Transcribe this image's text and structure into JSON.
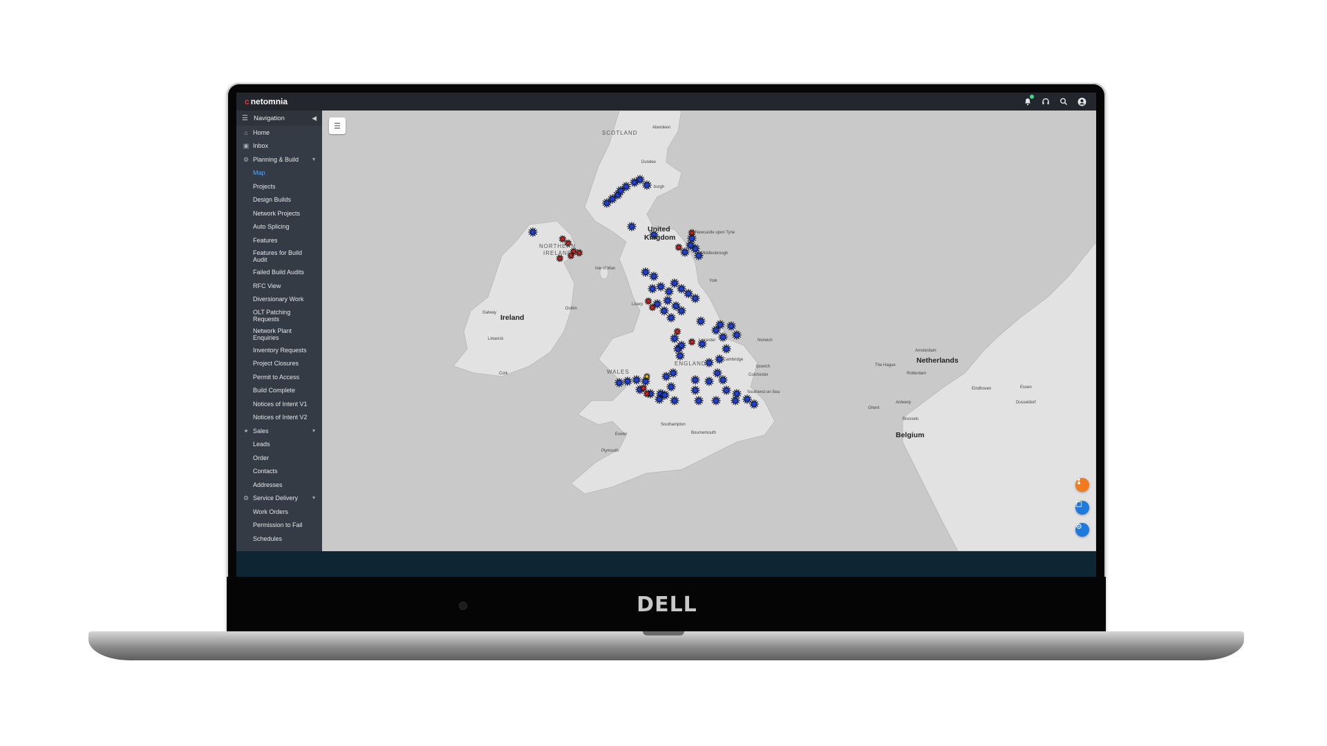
{
  "app": {
    "logo_mark": "c",
    "logo_text": "netomnia",
    "icons": [
      "bell-icon",
      "headset-icon",
      "search-icon",
      "user-icon"
    ]
  },
  "device": {
    "brand": "DELL"
  },
  "sidebar": {
    "header": "Navigation",
    "items": [
      {
        "label": "Home",
        "icon": "home-icon"
      },
      {
        "label": "Inbox",
        "icon": "inbox-icon"
      },
      {
        "label": "Planning & Build",
        "icon": "planning-icon"
      },
      {
        "label": "Map",
        "active": true
      },
      {
        "label": "Projects"
      },
      {
        "label": "Design Builds"
      },
      {
        "label": "Network Projects"
      },
      {
        "label": "Auto Splicing"
      },
      {
        "label": "Features"
      },
      {
        "label": "Features for Build Audit"
      },
      {
        "label": "Failed Build Audits"
      },
      {
        "label": "RFC View"
      },
      {
        "label": "Diversionary Work"
      },
      {
        "label": "OLT Patching Requests"
      },
      {
        "label": "Network Plant Enquiries"
      },
      {
        "label": "Inventory Requests"
      },
      {
        "label": "Project Closures"
      },
      {
        "label": "Permit to Access"
      },
      {
        "label": "Build Complete"
      },
      {
        "label": "Notices of Intent V1"
      },
      {
        "label": "Notices of Intent V2"
      },
      {
        "label": "Sales",
        "icon": "sales-icon"
      },
      {
        "label": "Leads"
      },
      {
        "label": "Order"
      },
      {
        "label": "Contacts"
      },
      {
        "label": "Addresses"
      },
      {
        "label": "Service Delivery",
        "icon": "service-icon"
      },
      {
        "label": "Work Orders"
      },
      {
        "label": "Permission to Fail"
      },
      {
        "label": "Schedules"
      }
    ]
  },
  "map": {
    "labels": {
      "scotland": "SCOTLAND",
      "uk_line1": "United",
      "uk_line2": "Kingdom",
      "isle_of_man": "Isle of Man",
      "ni_line1": "NORTHERN",
      "ni_line2": "IRELAND",
      "ireland": "Ireland",
      "dublin": "Dublin",
      "wales": "WALES",
      "england": "ENGLAND",
      "netherlands": "Netherlands",
      "belgium": "Belgium",
      "the_hague": "The Hague",
      "amsterdam": "Amsterdam",
      "rotterdam": "Rotterdam",
      "antwerp": "Antwerp",
      "brussels": "Brussels",
      "liverpool": "Liverp",
      "cambridge": "Cambridge",
      "york": "York",
      "southampton": "Southampton",
      "dundee": "Dundee",
      "aberdeen": "Aberdeen",
      "essen": "Essen",
      "dusseldorf": "Dusseldorf",
      "leicester": "Leicester",
      "newcastle": "Newcastle upon Tyne",
      "burgh": "burgh",
      "middlesbrough": "Middlesbrough",
      "ipswich": "Ipswich",
      "colchester": "Colchester",
      "southend": "Southend-on-Sea",
      "norwich": "Norwich",
      "cork": "Cork",
      "galway": "Galway",
      "limerick": "Limerick",
      "exeter": "Exeter",
      "plymouth": "Plymouth",
      "bournemouth": "Bournemouth",
      "ghent": "Ghent",
      "eindhoven": "Eindhoven"
    },
    "colors": {
      "blue_marker": "#1e3fd6",
      "red_marker": "#d62020",
      "yellow_marker": "#e8c31a",
      "sea": "#c9c9c9",
      "land": "#e3e3e3"
    }
  }
}
